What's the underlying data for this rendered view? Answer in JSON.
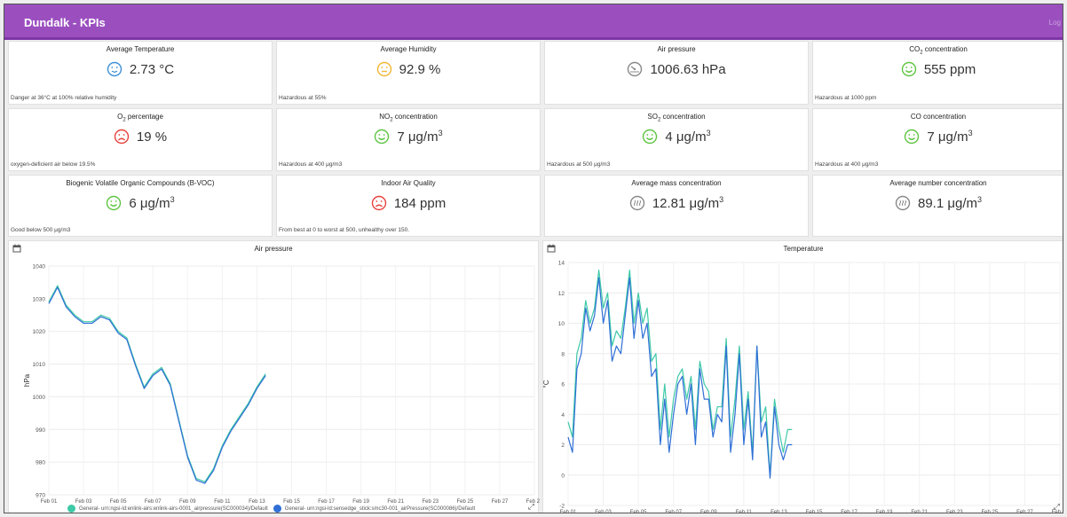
{
  "header": {
    "title": "Dundalk - KPIs",
    "logout": "Log"
  },
  "colors": {
    "header": "#9b4fbf",
    "good": "#5ec442",
    "warn": "#f2b632",
    "bad": "#e8413c",
    "neutral": "#888888",
    "cold": "#3d8fd6",
    "series1": "#3ec9a7",
    "series2": "#2f6fd6"
  },
  "kpis": [
    {
      "title": "Average Temperature",
      "value": "2.73 °C",
      "icon": "cold-face-icon",
      "note": "Danger at 36°C at 100% relative humidity"
    },
    {
      "title": "Average Humidity",
      "value": "92.9 %",
      "icon": "neutral-face-icon",
      "note": "Hazardous at 55%"
    },
    {
      "title": "Air pressure",
      "value": "1006.63 hPa",
      "icon": "gauge-icon",
      "note": ""
    },
    {
      "title": "CO₂ concentration",
      "value": "555 ppm",
      "icon": "happy-face-icon",
      "note": "Hazardous at 1000 ppm"
    },
    {
      "title": "O₂ percentage",
      "value": "19 %",
      "icon": "sad-face-icon",
      "note": "oxygen-deficient air below 19.5%"
    },
    {
      "title": "NO₂ concentration",
      "value": "7 μg/m³",
      "icon": "happy-face-icon",
      "note": "Hazardous at 400 μg/m3"
    },
    {
      "title": "SO₂ concentration",
      "value": "4 μg/m³",
      "icon": "happy-face-icon",
      "note": "Hazardous at 500 μg/m3"
    },
    {
      "title": "CO concentration",
      "value": "7 μg/m³",
      "icon": "happy-face-icon",
      "note": "Hazardous at 400 μg/m3"
    },
    {
      "title": "Biogenic Volatile Organic Compounds (B-VOC)",
      "value": "6 μg/m³",
      "icon": "happy-face-icon",
      "note": "Good below 500 μg/m3"
    },
    {
      "title": "Indoor Air Quality",
      "value": "184 ppm",
      "icon": "sad-face-icon",
      "note": "From best at 0 to worst at 500, unhealthy over 150."
    },
    {
      "title": "Average mass concentration",
      "value": "12.81 μg/m³",
      "icon": "particles-icon",
      "note": ""
    },
    {
      "title": "Average number concentration",
      "value": "89.1 μg/m³",
      "icon": "particles-icon",
      "note": ""
    }
  ],
  "charts": {
    "pressure": {
      "title": "Air pressure",
      "ylabel": "hPa",
      "legend": [
        "General- urn:ngsi-ld:enlink-airs:enlink-airs-0001_airpressure(SC000034)/Default",
        "General- urn:ngsi-ld:sensedge_stick:smc30-001_airPressure(SC000086)/Default"
      ]
    },
    "temperature": {
      "title": "Temperature",
      "ylabel": "°C"
    }
  },
  "chart_data": [
    {
      "type": "line",
      "title": "Air pressure",
      "ylabel": "hPa",
      "ylim": [
        970,
        1040
      ],
      "yticks": [
        970,
        980,
        990,
        1000,
        1010,
        1020,
        1030,
        1040
      ],
      "xticks": [
        "Feb 01",
        "Feb 03",
        "Feb 05",
        "Feb 07",
        "Feb 09",
        "Feb 11",
        "Feb 13",
        "Feb 15",
        "Feb 17",
        "Feb 19",
        "Feb 21",
        "Feb 23",
        "Feb 25",
        "Feb 27",
        "Feb 29"
      ],
      "xlim": [
        "Feb 01",
        "Feb 29"
      ],
      "series": [
        {
          "name": "General- urn:ngsi-ld:enlink-airs:enlink-airs-0001_airpressure(SC000034)/Default",
          "x": [
            "Feb 01",
            "Feb 01 12:00",
            "Feb 02",
            "Feb 02 12:00",
            "Feb 03",
            "Feb 03 12:00",
            "Feb 04",
            "Feb 04 12:00",
            "Feb 05",
            "Feb 05 12:00",
            "Feb 06",
            "Feb 06 12:00",
            "Feb 07",
            "Feb 07 12:00",
            "Feb 08",
            "Feb 08 12:00",
            "Feb 09",
            "Feb 09 12:00",
            "Feb 10",
            "Feb 10 12:00",
            "Feb 11",
            "Feb 11 12:00",
            "Feb 12",
            "Feb 12 12:00",
            "Feb 13",
            "Feb 13 12:00"
          ],
          "values": [
            1029,
            1034,
            1028,
            1025,
            1023,
            1023,
            1025,
            1024,
            1020,
            1018,
            1010,
            1003,
            1007,
            1009,
            1004,
            993,
            982,
            975,
            974,
            978,
            985,
            990,
            994,
            998,
            1003,
            1007
          ]
        },
        {
          "name": "General- urn:ngsi-ld:sensedge_stick:smc30-001_airPressure(SC000086)/Default",
          "x": [
            "Feb 01",
            "Feb 01 12:00",
            "Feb 02",
            "Feb 02 12:00",
            "Feb 03",
            "Feb 03 12:00",
            "Feb 04",
            "Feb 04 12:00",
            "Feb 05",
            "Feb 05 12:00",
            "Feb 06",
            "Feb 06 12:00",
            "Feb 07",
            "Feb 07 12:00",
            "Feb 08",
            "Feb 08 12:00",
            "Feb 09",
            "Feb 09 12:00",
            "Feb 10",
            "Feb 10 12:00",
            "Feb 11",
            "Feb 11 12:00",
            "Feb 12",
            "Feb 12 12:00",
            "Feb 13",
            "Feb 13 12:00"
          ],
          "values": [
            1028.5,
            1033.5,
            1027.5,
            1024.5,
            1022.5,
            1022.5,
            1024.5,
            1023.5,
            1019.5,
            1017.5,
            1009.5,
            1002.5,
            1006.5,
            1008.5,
            1003.5,
            992.5,
            981.5,
            974.5,
            973.5,
            977.5,
            984.5,
            989.5,
            993.5,
            997.5,
            1002.5,
            1006.5
          ]
        }
      ]
    },
    {
      "type": "line",
      "title": "Temperature",
      "ylabel": "°C",
      "ylim": [
        -2,
        14
      ],
      "yticks": [
        -2,
        0,
        2,
        4,
        6,
        8,
        10,
        12,
        14
      ],
      "xticks": [
        "Feb 01",
        "Feb 03",
        "Feb 05",
        "Feb 07",
        "Feb 09",
        "Feb 11",
        "Feb 13",
        "Feb 15",
        "Feb 17",
        "Feb 19",
        "Feb 21",
        "Feb 23",
        "Feb 25",
        "Feb 27",
        "Feb 29"
      ],
      "xlim": [
        "Feb 01",
        "Feb 29"
      ],
      "series": [
        {
          "x": [
            "Feb 01",
            "Feb 01 06:00",
            "Feb 01 12:00",
            "Feb 01 18:00",
            "Feb 02",
            "Feb 02 06:00",
            "Feb 02 12:00",
            "Feb 02 18:00",
            "Feb 03",
            "Feb 03 06:00",
            "Feb 03 12:00",
            "Feb 03 18:00",
            "Feb 04",
            "Feb 04 06:00",
            "Feb 04 12:00",
            "Feb 04 18:00",
            "Feb 05",
            "Feb 05 06:00",
            "Feb 05 12:00",
            "Feb 05 18:00",
            "Feb 06",
            "Feb 06 06:00",
            "Feb 06 12:00",
            "Feb 06 18:00",
            "Feb 07",
            "Feb 07 06:00",
            "Feb 07 12:00",
            "Feb 07 18:00",
            "Feb 08",
            "Feb 08 06:00",
            "Feb 08 12:00",
            "Feb 08 18:00",
            "Feb 09",
            "Feb 09 06:00",
            "Feb 09 12:00",
            "Feb 09 18:00",
            "Feb 10",
            "Feb 10 06:00",
            "Feb 10 12:00",
            "Feb 10 18:00",
            "Feb 11",
            "Feb 11 06:00",
            "Feb 11 12:00",
            "Feb 11 18:00",
            "Feb 12",
            "Feb 12 06:00",
            "Feb 12 12:00",
            "Feb 12 18:00",
            "Feb 13",
            "Feb 13 06:00",
            "Feb 13 12:00",
            "Feb 13 18:00"
          ],
          "values": [
            3.5,
            2.5,
            8,
            9,
            11.5,
            10,
            11,
            13.5,
            11,
            12,
            8.5,
            9.5,
            9,
            11,
            13.5,
            10,
            12,
            10,
            11,
            7.5,
            8,
            3,
            6,
            2.5,
            5,
            6.5,
            7,
            5,
            6.5,
            3,
            7.5,
            6,
            5.5,
            3,
            4.5,
            4.5,
            9,
            2.5,
            5,
            8.5,
            3,
            5.5,
            1.5,
            8.5,
            3.5,
            4.5,
            0,
            5,
            3,
            1.5,
            3,
            3
          ]
        },
        {
          "x": [
            "Feb 01",
            "Feb 01 06:00",
            "Feb 01 12:00",
            "Feb 01 18:00",
            "Feb 02",
            "Feb 02 06:00",
            "Feb 02 12:00",
            "Feb 02 18:00",
            "Feb 03",
            "Feb 03 06:00",
            "Feb 03 12:00",
            "Feb 03 18:00",
            "Feb 04",
            "Feb 04 06:00",
            "Feb 04 12:00",
            "Feb 04 18:00",
            "Feb 05",
            "Feb 05 06:00",
            "Feb 05 12:00",
            "Feb 05 18:00",
            "Feb 06",
            "Feb 06 06:00",
            "Feb 06 12:00",
            "Feb 06 18:00",
            "Feb 07",
            "Feb 07 06:00",
            "Feb 07 12:00",
            "Feb 07 18:00",
            "Feb 08",
            "Feb 08 06:00",
            "Feb 08 12:00",
            "Feb 08 18:00",
            "Feb 09",
            "Feb 09 06:00",
            "Feb 09 12:00",
            "Feb 09 18:00",
            "Feb 10",
            "Feb 10 06:00",
            "Feb 10 12:00",
            "Feb 10 18:00",
            "Feb 11",
            "Feb 11 06:00",
            "Feb 11 12:00",
            "Feb 11 18:00",
            "Feb 12",
            "Feb 12 06:00",
            "Feb 12 12:00",
            "Feb 12 18:00",
            "Feb 13",
            "Feb 13 06:00",
            "Feb 13 12:00",
            "Feb 13 18:00"
          ],
          "values": [
            2.5,
            1.5,
            7,
            8,
            11,
            9.5,
            10.5,
            13,
            10,
            11.5,
            7.5,
            8.5,
            8,
            10.5,
            13,
            9,
            11.5,
            9,
            10,
            6.5,
            7,
            2,
            5,
            1.5,
            4,
            6,
            6.5,
            4,
            6,
            2,
            7,
            5,
            5,
            2.5,
            4,
            3.5,
            8.5,
            1.5,
            4,
            8,
            2,
            5,
            1,
            8.5,
            2.5,
            3.5,
            -0.2,
            4.5,
            2,
            1,
            2,
            2
          ]
        }
      ]
    }
  ]
}
